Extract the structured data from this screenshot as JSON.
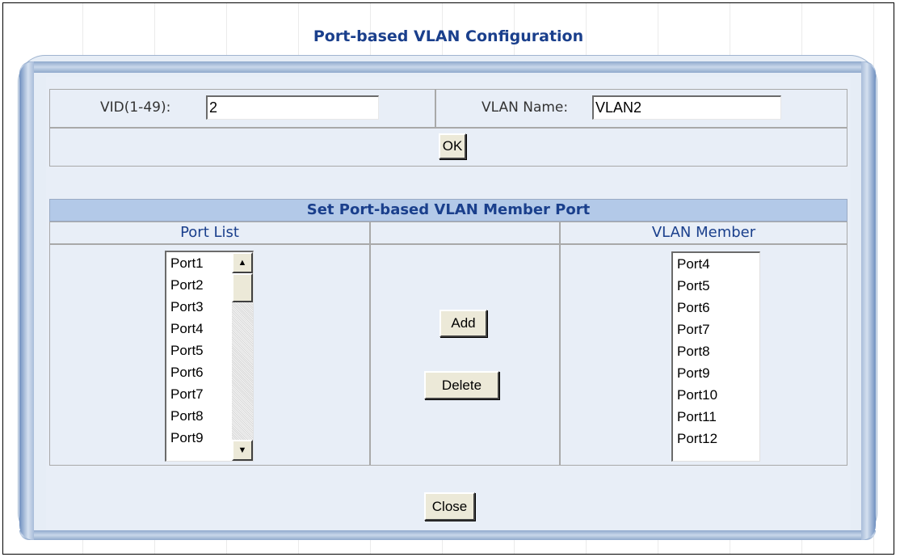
{
  "page": {
    "title": "Port-based  VLAN Configuration"
  },
  "form": {
    "vid_label": "VID(1-49):",
    "vid_value": "2",
    "name_label": "VLAN Name:",
    "name_value": "VLAN2",
    "ok_label": "OK"
  },
  "member": {
    "section_title": "Set Port-based VLAN Member Port",
    "port_list_header": "Port List",
    "vlan_member_header": "VLAN Member",
    "add_label": "Add",
    "delete_label": "Delete",
    "port_list": [
      "Port1",
      "Port2",
      "Port3",
      "Port4",
      "Port5",
      "Port6",
      "Port7",
      "Port8",
      "Port9"
    ],
    "vlan_member_list": [
      "Port4",
      "Port5",
      "Port6",
      "Port7",
      "Port8",
      "Port9",
      "Port10",
      "Port11",
      "Port12"
    ]
  },
  "footer": {
    "close_label": "Close"
  },
  "icons": {
    "scroll_up": "arrow-up-icon",
    "scroll_down": "arrow-down-icon"
  },
  "colors": {
    "title": "#1a3f8c",
    "panel": "#e8eef7",
    "section_head": "#b3c9e8"
  }
}
